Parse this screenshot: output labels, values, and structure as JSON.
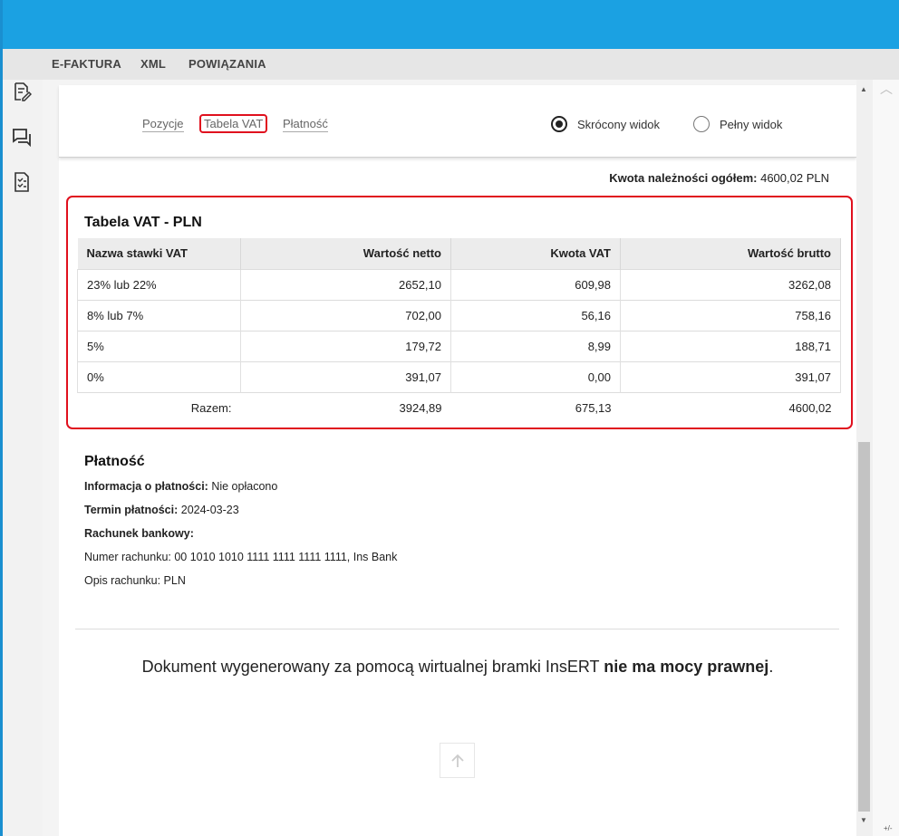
{
  "tabs": [
    "E-FAKTURA",
    "XML",
    "POWIĄZANIA"
  ],
  "sidebar": {
    "icons": [
      "edit-document-icon",
      "comments-icon",
      "document-tasks-icon"
    ]
  },
  "nav": {
    "links": [
      "Pozycje",
      "Tabela VAT",
      "Płatność"
    ],
    "active": "Tabela VAT",
    "view_short": "Skrócony widok",
    "view_full": "Pełny widok",
    "selected_view": "Skrócony widok"
  },
  "total": {
    "label": "Kwota należności ogółem:",
    "value": "4600,02 PLN"
  },
  "vat": {
    "title": "Tabela VAT - PLN",
    "headers": [
      "Nazwa stawki VAT",
      "Wartość netto",
      "Kwota VAT",
      "Wartość brutto"
    ],
    "rows": [
      [
        "23% lub 22%",
        "2652,10",
        "609,98",
        "3262,08"
      ],
      [
        "8% lub 7%",
        "702,00",
        "56,16",
        "758,16"
      ],
      [
        "5%",
        "179,72",
        "8,99",
        "188,71"
      ],
      [
        "0%",
        "391,07",
        "0,00",
        "391,07"
      ]
    ],
    "sum": [
      "Razem:",
      "3924,89",
      "675,13",
      "4600,02"
    ]
  },
  "payment": {
    "title": "Płatność",
    "info_label": "Informacja o płatności:",
    "info_value": "Nie opłacono",
    "due_label": "Termin płatności:",
    "due_value": "2024-03-23",
    "bank_label": "Rachunek bankowy:",
    "account_number": "Numer rachunku: 00 1010 1010 1111 1111 1111 1111, Ins Bank",
    "account_desc": "Opis rachunku: PLN"
  },
  "footer": {
    "text_normal": "Dokument wygenerowany za pomocą wirtualnej bramki InsERT ",
    "text_bold": "nie ma mocy prawnej",
    "text_end": "."
  },
  "rail_text": "+/-",
  "colors": {
    "titlebar": "#1ba1e2",
    "highlight": "#e0101e"
  }
}
